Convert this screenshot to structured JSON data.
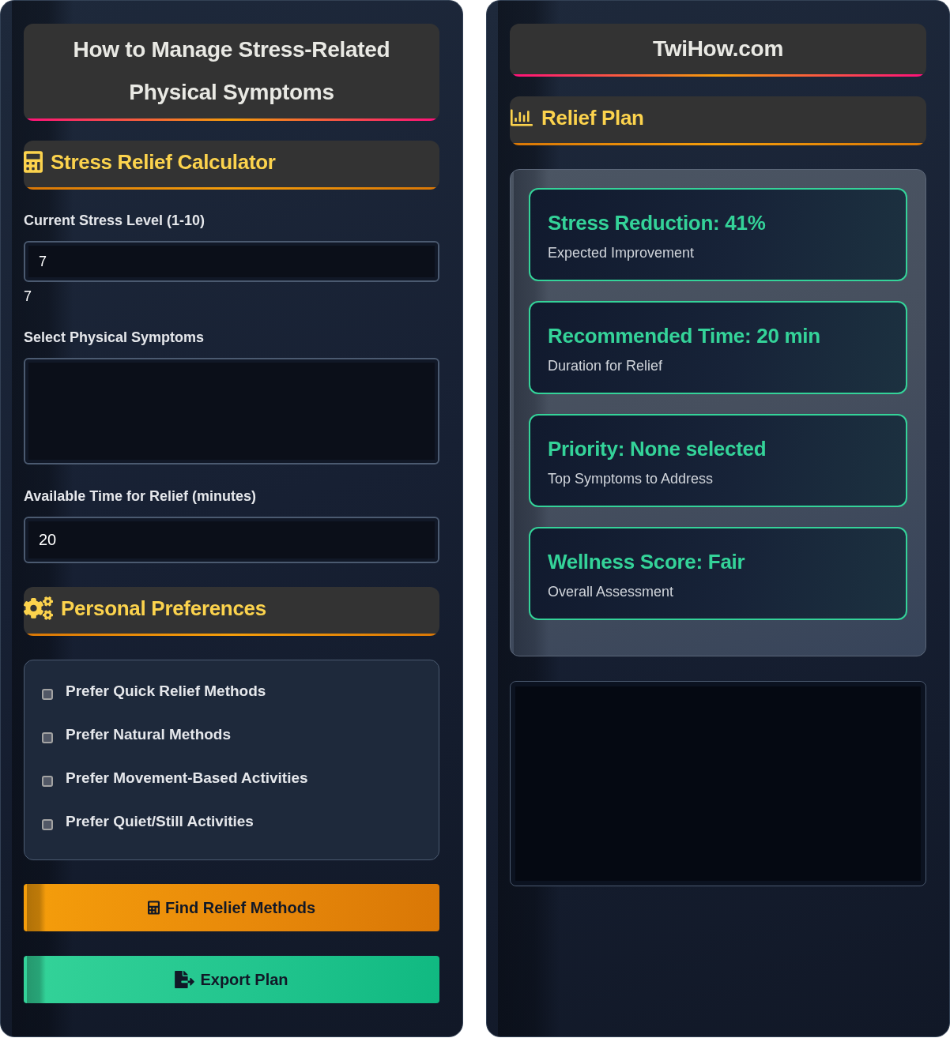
{
  "left_panel": {
    "title": "How to Manage Stress-Related Physical Symptoms",
    "calculator": {
      "heading": {
        "kind": "calculator",
        "text": "Stress Relief Calculator"
      },
      "fields": [
        {
          "kind": "number",
          "label": "Current Stress Level (1-10)",
          "value": "7",
          "reading": "7"
        },
        {
          "kind": "listbox",
          "label": "Select Physical Symptoms"
        },
        {
          "kind": "number",
          "label": "Available Time for Relief (minutes)",
          "value": "20"
        }
      ]
    },
    "preferences": {
      "heading": {
        "kind": "settings",
        "text": "Personal Preferences"
      },
      "options": [
        {
          "label": "Prefer Quick Relief Methods",
          "checked": false
        },
        {
          "label": "Prefer Natural Methods",
          "checked": false
        },
        {
          "label": "Prefer Movement-Based Activities",
          "checked": false
        },
        {
          "label": "Prefer Quiet/Still Activities",
          "checked": false
        }
      ]
    },
    "buttons": [
      {
        "kind": "calculate",
        "label": "Find Relief Methods"
      },
      {
        "kind": "export",
        "label": "Export Plan"
      }
    ]
  },
  "right_panel": {
    "site_title": "TwiHow.com",
    "relief_plan": {
      "heading": {
        "kind": "chart",
        "text": "Relief Plan"
      },
      "results": [
        {
          "title": "Stress Reduction: 41%",
          "caption": "Expected Improvement"
        },
        {
          "title": "Recommended Time: 20 min",
          "caption": "Duration for Relief"
        },
        {
          "title": "Priority: None selected",
          "caption": "Top Symptoms to Address"
        },
        {
          "title": "Wellness Score: Fair",
          "caption": "Overall Assessment"
        }
      ]
    }
  }
}
